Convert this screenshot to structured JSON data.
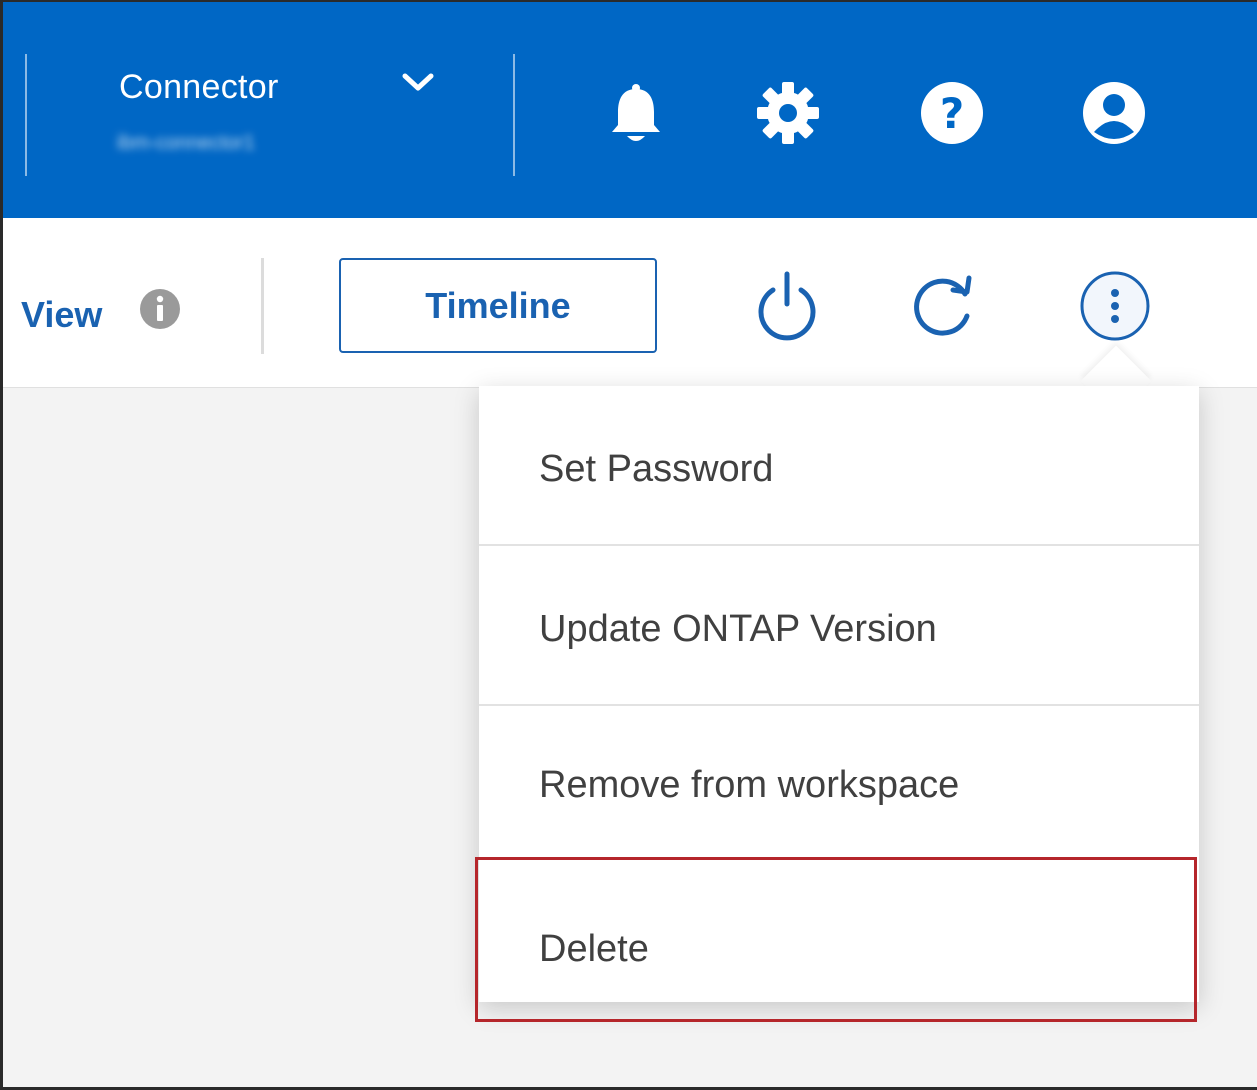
{
  "header": {
    "connector": {
      "label": "Connector",
      "name": "ibm-connector1",
      "chevron_icon": "chevron-down-icon"
    },
    "icons": [
      "bell-icon",
      "gear-icon",
      "help-icon",
      "user-icon"
    ]
  },
  "toolbar": {
    "view_label": "View",
    "info_icon": "info-icon",
    "timeline_label": "Timeline",
    "icons": [
      "power-icon",
      "refresh-icon",
      "more-options-icon"
    ]
  },
  "menu": {
    "items": [
      {
        "label": "Set Password"
      },
      {
        "label": "Update ONTAP Version"
      },
      {
        "label": "Remove from workspace"
      },
      {
        "label": "Delete"
      }
    ]
  },
  "colors": {
    "header_bg": "#0067c5",
    "link_blue": "#1a62b1",
    "highlight_red": "#b5262b",
    "canvas_bg": "#f3f3f3"
  }
}
